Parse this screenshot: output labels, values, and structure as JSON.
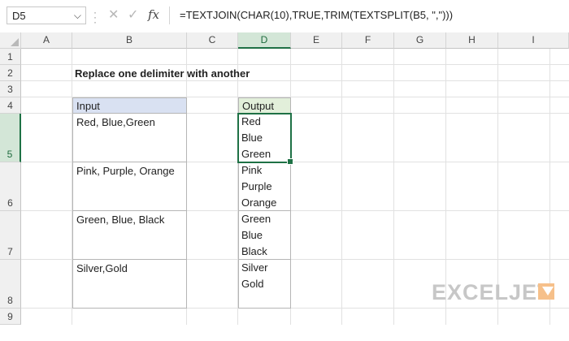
{
  "name_box": {
    "value": "D5"
  },
  "formula_bar": {
    "cancel_icon": "x-icon",
    "enter_icon": "check-icon",
    "fx_label": "fx",
    "formula": "=TEXTJOIN(CHAR(10),TRUE,TRIM(TEXTSPLIT(B5, \",\")))"
  },
  "columns": [
    "A",
    "B",
    "C",
    "D",
    "E",
    "F",
    "G",
    "H",
    "I"
  ],
  "rows": [
    "1",
    "2",
    "3",
    "4",
    "5",
    "6",
    "7",
    "8",
    "9"
  ],
  "active_cell": {
    "column": "D",
    "row": "5"
  },
  "sheet": {
    "title": "Replace one delimiter with another",
    "input_header": "Input",
    "output_header": "Output",
    "inputs": [
      "Red, Blue,Green",
      "Pink, Purple, Orange",
      "Green, Blue, Black",
      "Silver,Gold"
    ],
    "outputs": [
      [
        "Red",
        "Blue",
        "Green"
      ],
      [
        "Pink",
        "Purple",
        "Orange"
      ],
      [
        "Green",
        "Blue",
        "Black"
      ],
      [
        "Silver",
        "Gold"
      ]
    ]
  },
  "colors": {
    "input_header_fill": "#d9e1f2",
    "output_header_fill": "#e2efda",
    "selection": "#1e7145"
  },
  "logo": {
    "text": "EXCELJET"
  }
}
